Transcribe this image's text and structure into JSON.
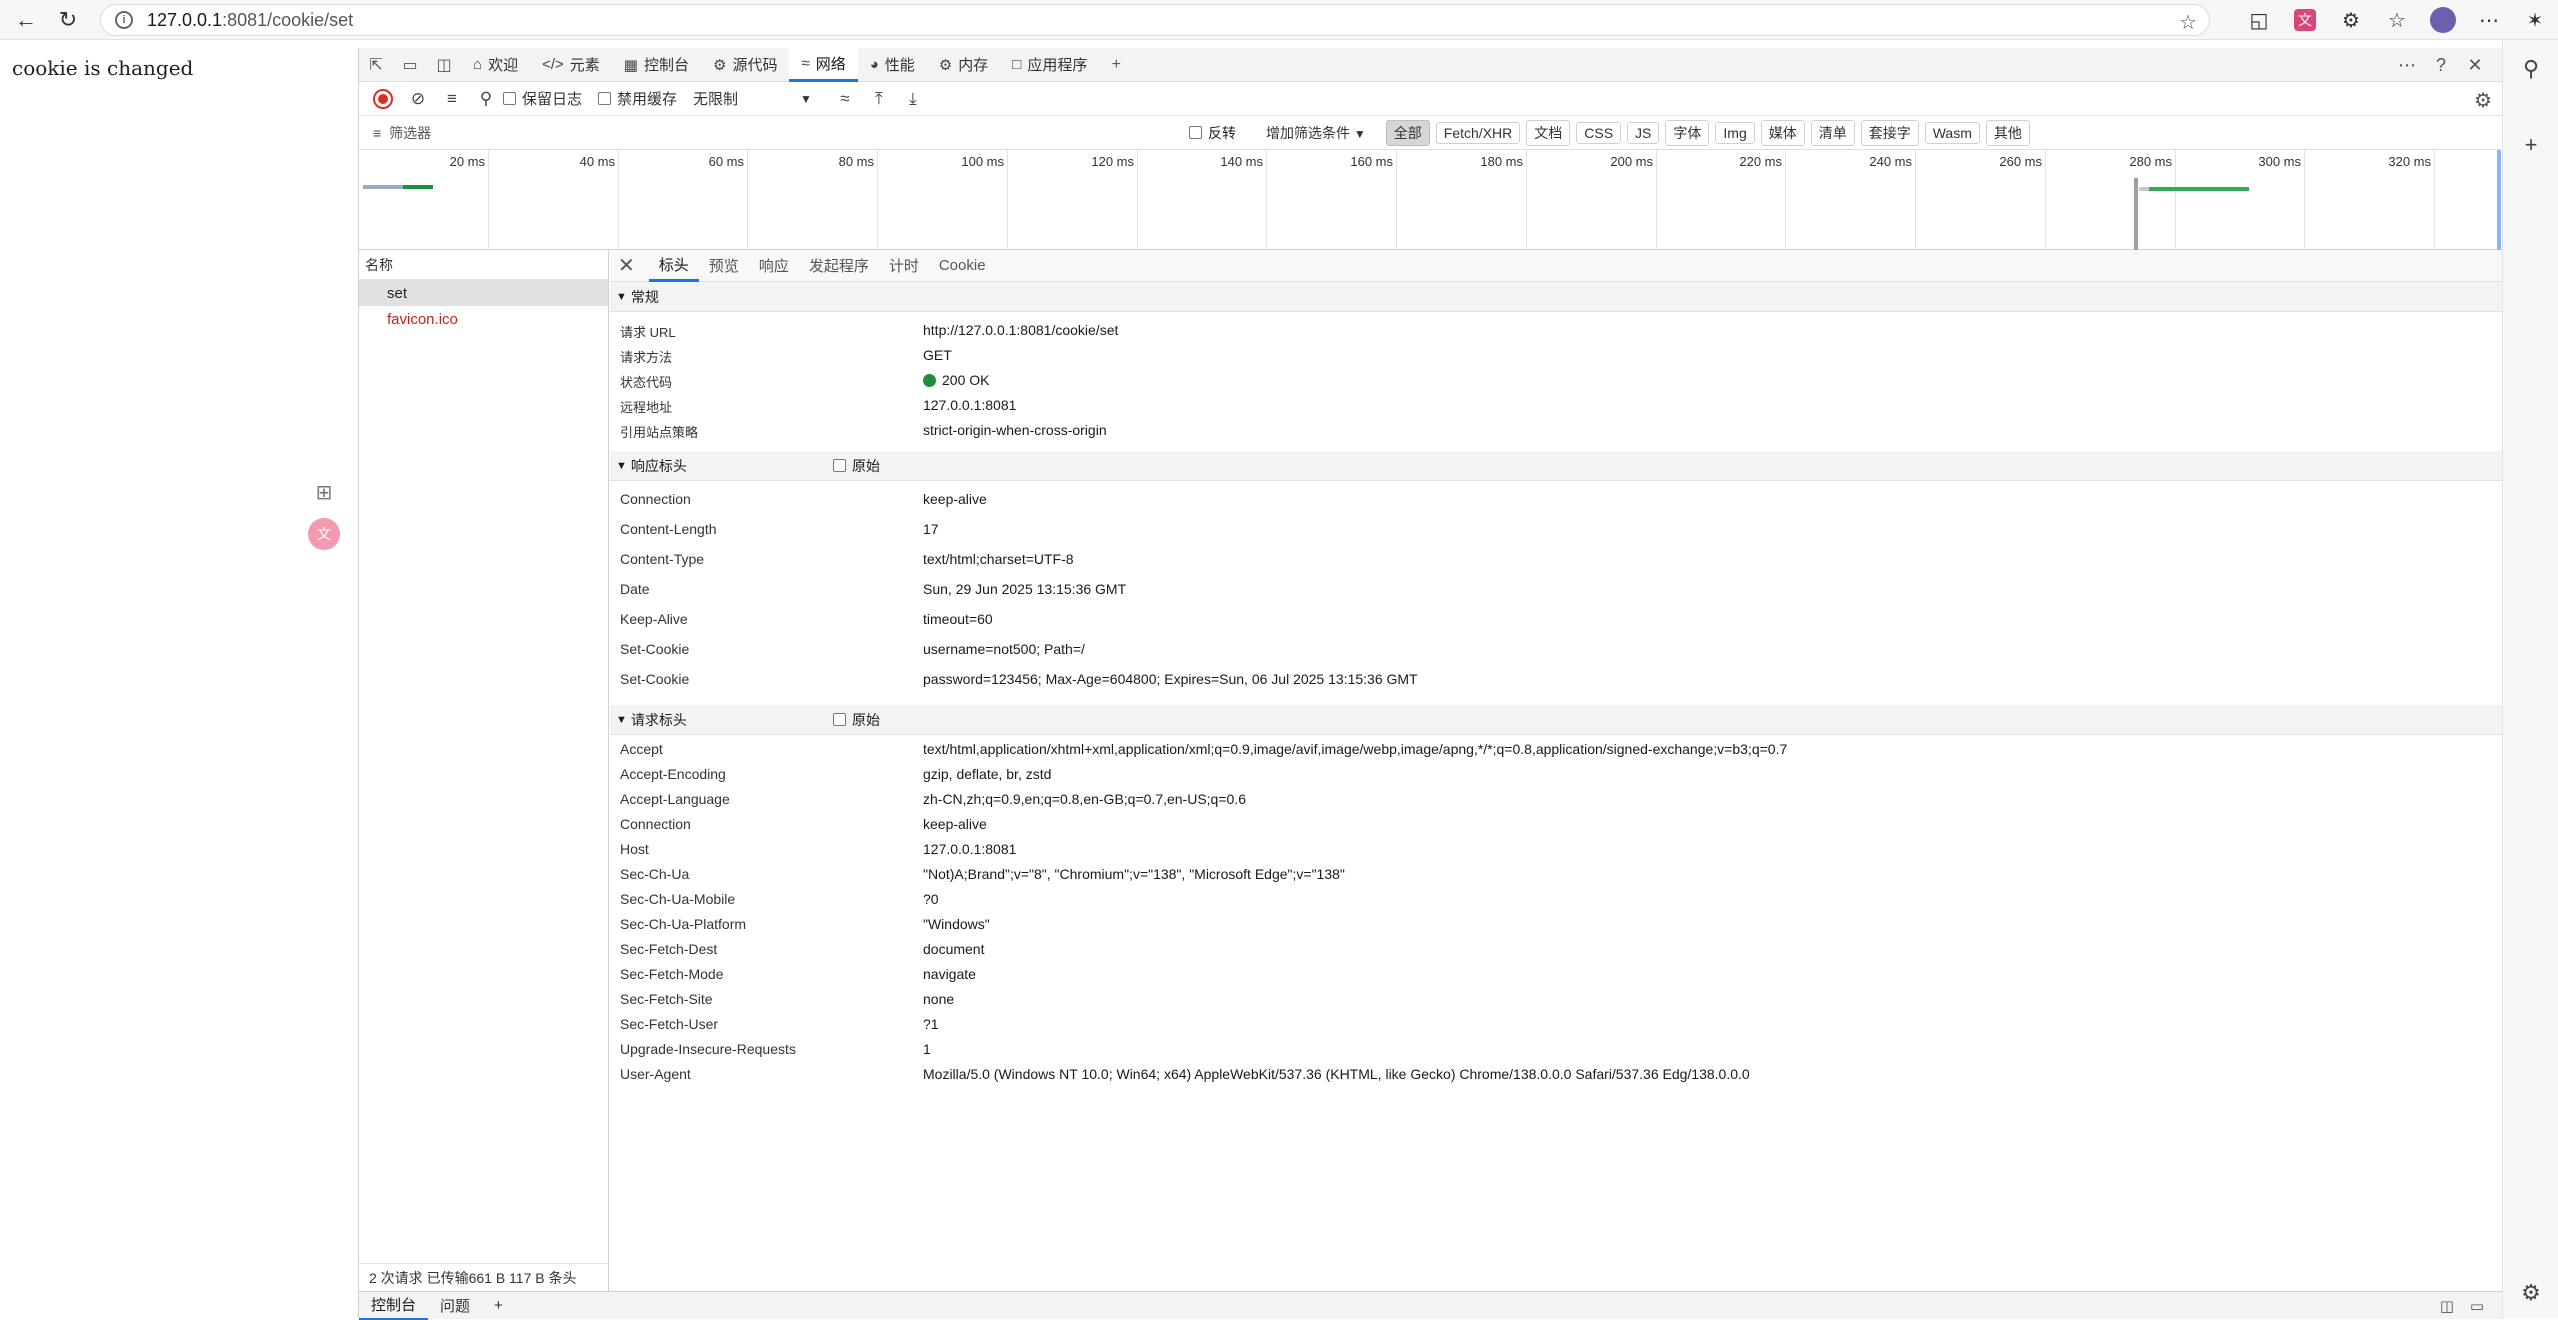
{
  "browser": {
    "url_host": "127.0.0.1",
    "url_rest": ":8081/cookie/set"
  },
  "page": {
    "message": "cookie is changed"
  },
  "devtools": {
    "tabs": [
      {
        "label": "欢迎"
      },
      {
        "label": "元素"
      },
      {
        "label": "控制台"
      },
      {
        "label": "源代码"
      },
      {
        "label": "网络"
      },
      {
        "label": "性能"
      },
      {
        "label": "内存"
      },
      {
        "label": "应用程序"
      }
    ],
    "toolbar": {
      "preserve_log": "保留日志",
      "disable_cache": "禁用缓存",
      "throttling": "无限制"
    },
    "filter": {
      "placeholder": "筛选器",
      "invert": "反转",
      "add_filter": "增加筛选条件",
      "chips": [
        "全部",
        "Fetch/XHR",
        "文档",
        "CSS",
        "JS",
        "字体",
        "Img",
        "媒体",
        "清单",
        "套接字",
        "Wasm",
        "其他"
      ]
    },
    "timeline_ticks": [
      "20 ms",
      "40 ms",
      "60 ms",
      "80 ms",
      "100 ms",
      "120 ms",
      "140 ms",
      "160 ms",
      "180 ms",
      "200 ms",
      "220 ms",
      "240 ms",
      "260 ms",
      "280 ms",
      "300 ms",
      "320 ms"
    ],
    "names_header": "名称",
    "requests": [
      {
        "name": "set"
      },
      {
        "name": "favicon.ico"
      }
    ],
    "status_bar": "2 次请求   已传输661 B   117 B 条头",
    "detail_tabs": [
      "标头",
      "预览",
      "响应",
      "发起程序",
      "计时",
      "Cookie"
    ],
    "general": {
      "title": "常规",
      "rows": [
        {
          "k": "请求 URL",
          "v": "http://127.0.0.1:8081/cookie/set"
        },
        {
          "k": "请求方法",
          "v": "GET"
        },
        {
          "k": "状态代码",
          "v": "200 OK"
        },
        {
          "k": "远程地址",
          "v": "127.0.0.1:8081"
        },
        {
          "k": "引用站点策略",
          "v": "strict-origin-when-cross-origin"
        }
      ]
    },
    "response_headers": {
      "title": "响应标头",
      "raw": "原始",
      "rows": [
        {
          "k": "Connection",
          "v": "keep-alive"
        },
        {
          "k": "Content-Length",
          "v": "17"
        },
        {
          "k": "Content-Type",
          "v": "text/html;charset=UTF-8"
        },
        {
          "k": "Date",
          "v": "Sun, 29 Jun 2025 13:15:36 GMT"
        },
        {
          "k": "Keep-Alive",
          "v": "timeout=60"
        },
        {
          "k": "Set-Cookie",
          "v": "username=not500; Path=/"
        },
        {
          "k": "Set-Cookie",
          "v": "password=123456; Max-Age=604800; Expires=Sun, 06 Jul 2025 13:15:36 GMT"
        }
      ]
    },
    "request_headers": {
      "title": "请求标头",
      "raw": "原始",
      "rows": [
        {
          "k": "Accept",
          "v": "text/html,application/xhtml+xml,application/xml;q=0.9,image/avif,image/webp,image/apng,*/*;q=0.8,application/signed-exchange;v=b3;q=0.7"
        },
        {
          "k": "Accept-Encoding",
          "v": "gzip, deflate, br, zstd"
        },
        {
          "k": "Accept-Language",
          "v": "zh-CN,zh;q=0.9,en;q=0.8,en-GB;q=0.7,en-US;q=0.6"
        },
        {
          "k": "Connection",
          "v": "keep-alive"
        },
        {
          "k": "Host",
          "v": "127.0.0.1:8081"
        },
        {
          "k": "Sec-Ch-Ua",
          "v": "\"Not)A;Brand\";v=\"8\", \"Chromium\";v=\"138\", \"Microsoft Edge\";v=\"138\""
        },
        {
          "k": "Sec-Ch-Ua-Mobile",
          "v": "?0"
        },
        {
          "k": "Sec-Ch-Ua-Platform",
          "v": "\"Windows\""
        },
        {
          "k": "Sec-Fetch-Dest",
          "v": "document"
        },
        {
          "k": "Sec-Fetch-Mode",
          "v": "navigate"
        },
        {
          "k": "Sec-Fetch-Site",
          "v": "none"
        },
        {
          "k": "Sec-Fetch-User",
          "v": "?1"
        },
        {
          "k": "Upgrade-Insecure-Requests",
          "v": "1"
        },
        {
          "k": "User-Agent",
          "v": "Mozilla/5.0 (Windows NT 10.0; Win64; x64) AppleWebKit/537.36 (KHTML, like Gecko) Chrome/138.0.0.0 Safari/537.36 Edg/138.0.0.0"
        }
      ]
    },
    "drawer": {
      "console": "控制台",
      "issues": "问题"
    },
    "colors": {
      "accent": "#1a73e8",
      "status_ok": "#1e8e3e",
      "error_text": "#c5221f",
      "record": "#d93025"
    }
  }
}
